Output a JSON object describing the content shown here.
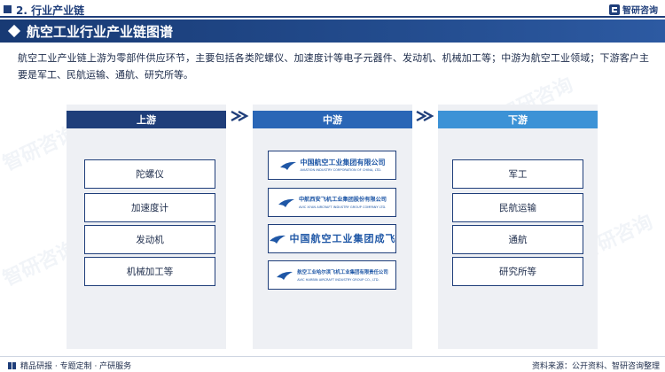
{
  "section": {
    "label": "2. 行业产业链"
  },
  "brand": {
    "name": "智研咨询",
    "color": "#1f3e7a"
  },
  "title": {
    "text": "航空工业行业产业链图谱"
  },
  "intro": "航空工业产业链上游为零部件供应环节，主要包括各类陀螺仪、加速度计等电子元器件、发动机、机械加工等；中游为航空工业领域；下游客户主要是军工、民航运输、通航、研究所等。",
  "upstream": {
    "title": "上游",
    "items": [
      "陀螺仪",
      "加速度计",
      "发动机",
      "机械加工等"
    ]
  },
  "midstream": {
    "title": "中游",
    "logos": [
      {
        "cn": "中国航空工业集团有限公司",
        "en": "AVIATION INDUSTRY CORPORATION OF CHINA, LTD."
      },
      {
        "cn": "中航西安飞机工业集团股份有限公司",
        "en": "AVIC XI'AN AIRCRAFT INDUSTRY GROUP COMPANY LTD."
      },
      {
        "cn": "中国航空工业集团成飞",
        "en": ""
      },
      {
        "cn": "航空工业哈尔滨飞机工业集团有限责任公司",
        "en": "AVIC HARBIN AIRCRAFT INDUSTRY GROUP CO., LTD."
      }
    ]
  },
  "downstream": {
    "title": "下游",
    "items": [
      "军工",
      "民航运输",
      "通航",
      "研究所等"
    ]
  },
  "watermark": "智研咨询",
  "footer": {
    "left": "精品研报 · 专题定制 · 产研服务",
    "right": "资料来源：公开资料、智研咨询整理"
  },
  "colors": {
    "navy": "#1f3e7a",
    "mid_blue": "#2a66b6",
    "light_blue": "#3c92d6",
    "panel_bg": "#eef0f4"
  }
}
